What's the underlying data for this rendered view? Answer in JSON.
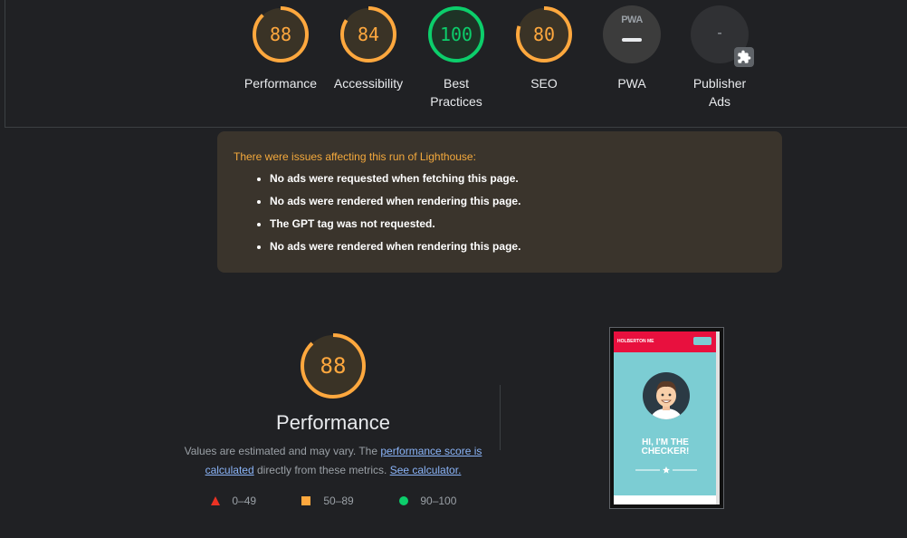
{
  "gauges": [
    {
      "name": "performance",
      "score": "88",
      "label": "Performance",
      "color": "#ffa83e",
      "fraction": 0.88
    },
    {
      "name": "accessibility",
      "score": "84",
      "label": "Accessibility",
      "color": "#ffa83e",
      "fraction": 0.84
    },
    {
      "name": "best-practices",
      "score": "100",
      "label": "Best Practices",
      "color": "#0cce6b",
      "fraction": 1.0
    },
    {
      "name": "seo",
      "score": "80",
      "label": "SEO",
      "color": "#ffa83e",
      "fraction": 0.8
    }
  ],
  "pwa": {
    "badge": "PWA",
    "label": "PWA"
  },
  "publisher_ads": {
    "score": "-",
    "label": "Publisher Ads",
    "plugin_icon": "puzzle-icon"
  },
  "warning": {
    "title": "There were issues affecting this run of Lighthouse:",
    "items": [
      "No ads were requested when fetching this page.",
      "No ads were rendered when rendering this page.",
      "The GPT tag was not requested.",
      "No ads were rendered when rendering this page."
    ]
  },
  "performance_section": {
    "score": "88",
    "fraction": 0.88,
    "title": "Performance",
    "desc_prefix": "Values are estimated and may vary. The ",
    "link_score": "performance score is calculated",
    "desc_middle": " directly from these metrics. ",
    "link_calc": "See calculator.",
    "legend": [
      {
        "shape": "triangle",
        "range": "0–49",
        "color": "#eb3223"
      },
      {
        "shape": "square",
        "range": "50–89",
        "color": "#ffa83e"
      },
      {
        "shape": "circle",
        "range": "90–100",
        "color": "#0cce6b"
      }
    ]
  },
  "screenshot": {
    "brand": "HOLBERTON ME",
    "heading_line1": "HI, I'M THE",
    "heading_line2": "CHECKER!"
  },
  "colors": {
    "fail": "#eb3223",
    "average": "#ffa83e",
    "pass": "#0cce6b",
    "background": "#202124"
  }
}
